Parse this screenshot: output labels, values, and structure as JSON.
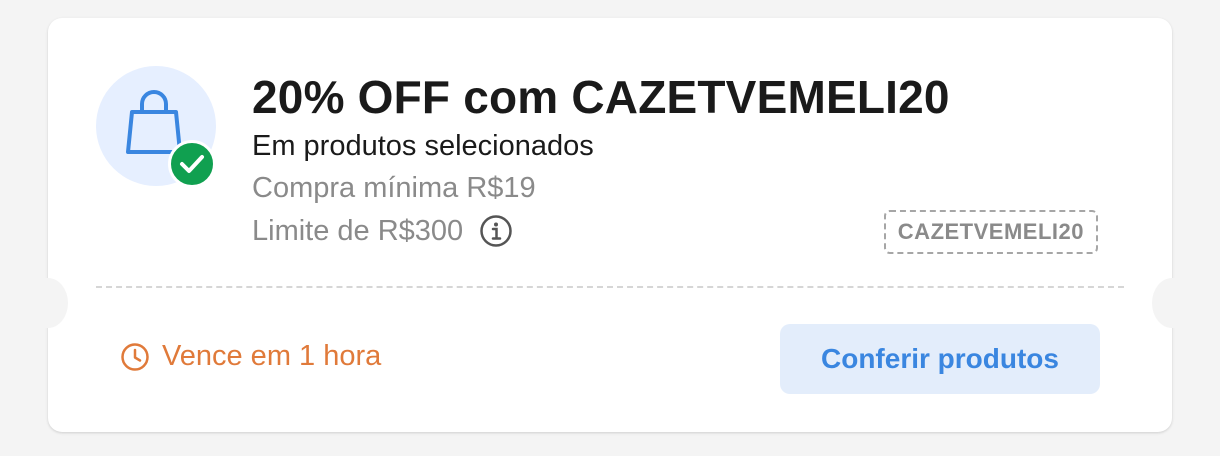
{
  "coupon": {
    "title": "20% OFF com CAZETVEMELI20",
    "subtitle": "Em produtos selecionados",
    "min_purchase": "Compra mínima R$19",
    "limit": "Limite de R$300",
    "code": "CAZETVEMELI20",
    "expiry": "Vence em 1 hora",
    "cta_label": "Conferir produtos",
    "icons": {
      "main": "shopping-bag-icon",
      "badge": "check-icon",
      "info": "info-icon",
      "clock": "clock-icon"
    },
    "colors": {
      "accent_blue": "#3a86e0",
      "success_green": "#10a050",
      "warning_orange": "#e07a3a",
      "icon_bg": "#e6efff",
      "cta_bg": "#e3edfb"
    }
  }
}
